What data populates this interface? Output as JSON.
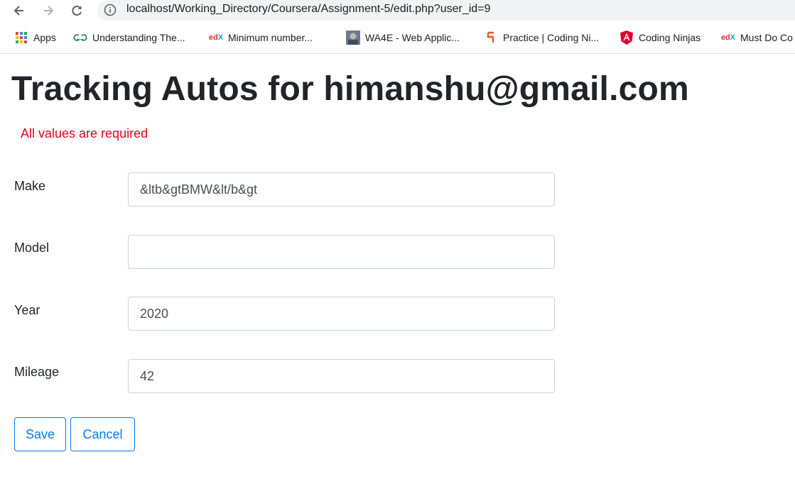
{
  "browser": {
    "url": "localhost/Working_Directory/Coursera/Assignment-5/edit.php?user_id=9",
    "bookmarks": [
      {
        "label": "Apps",
        "icon": "apps-grid-icon"
      },
      {
        "label": "Understanding The...",
        "icon": "geeksforgeeks-icon"
      },
      {
        "label": "Minimum number...",
        "icon": "edx-icon"
      },
      {
        "label": "WA4E - Web Applic...",
        "icon": "wa4e-avatar-icon"
      },
      {
        "label": "Practice | Coding Ni...",
        "icon": "coding-ninjas-icon"
      },
      {
        "label": "Coding Ninjas",
        "icon": "angular-icon"
      },
      {
        "label": "Must Do Co",
        "icon": "edx-icon"
      }
    ]
  },
  "page": {
    "title": "Tracking Autos for himanshu@gmail.com",
    "error": "All values are required",
    "fields": {
      "make": {
        "label": "Make",
        "value": "&ltb&gtBMW&lt/b&gt"
      },
      "model": {
        "label": "Model",
        "value": ""
      },
      "year": {
        "label": "Year",
        "value": "2020"
      },
      "mileage": {
        "label": "Mileage",
        "value": "42"
      }
    },
    "buttons": {
      "save": "Save",
      "cancel": "Cancel"
    }
  },
  "colors": {
    "accent": "#007bff",
    "error": "#e8001c",
    "text": "#212529"
  }
}
